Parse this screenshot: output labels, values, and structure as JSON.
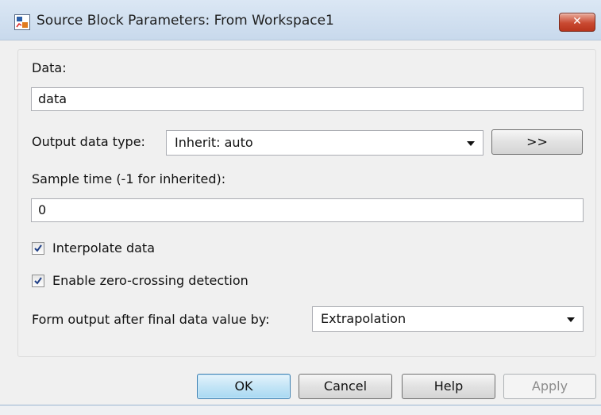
{
  "window": {
    "title": "Source Block Parameters: From Workspace1",
    "close_glyph": "✕"
  },
  "form": {
    "data_label": "Data:",
    "data_value": "data",
    "output_type_label": "Output data type:",
    "output_type_value": "Inherit: auto",
    "assistant_button": ">>",
    "sample_time_label": "Sample time (-1 for inherited):",
    "sample_time_value": "0",
    "interpolate_label": "Interpolate data",
    "interpolate_checked": true,
    "zero_crossing_label": "Enable zero-crossing detection",
    "zero_crossing_checked": true,
    "form_output_label": "Form output after final data value by:",
    "form_output_value": "Extrapolation"
  },
  "buttons": {
    "ok": "OK",
    "cancel": "Cancel",
    "help": "Help",
    "apply": "Apply"
  },
  "colors": {
    "accent": "#3c7fb1",
    "close": "#c94a32"
  }
}
